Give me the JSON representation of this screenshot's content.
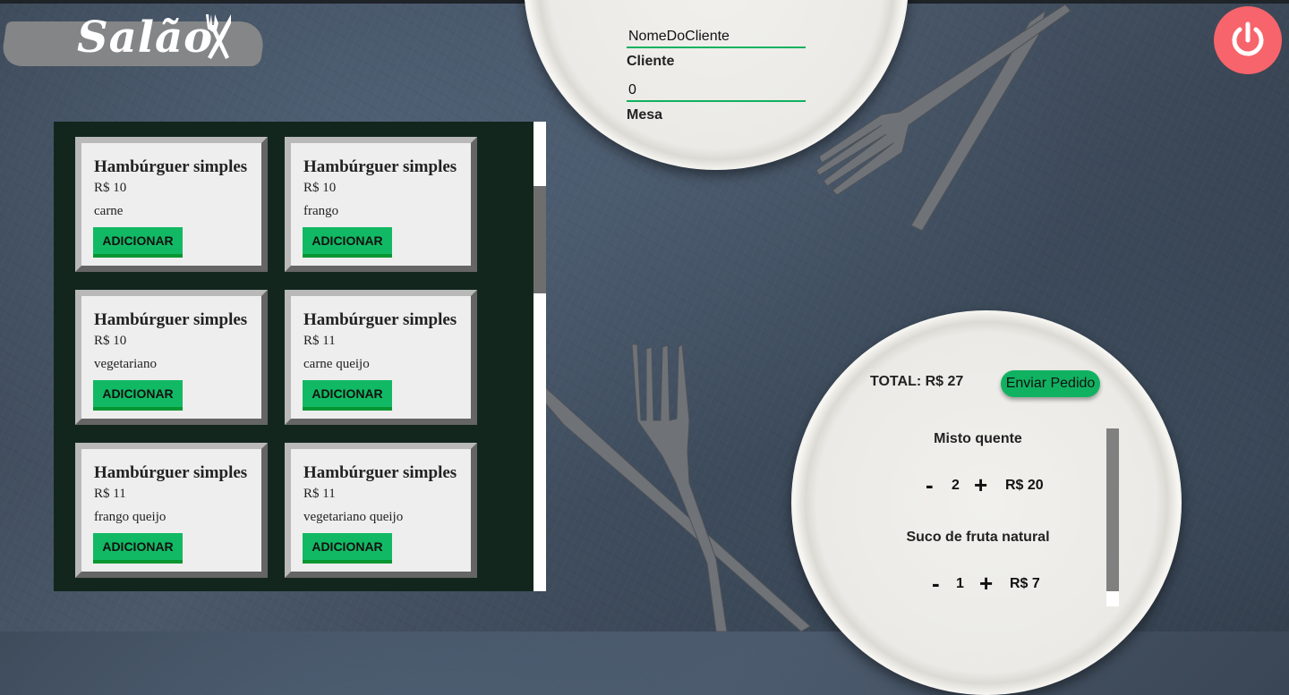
{
  "header": {
    "logo_text": "Salão"
  },
  "customer": {
    "name_value": "NomeDoCliente",
    "name_label": "Cliente",
    "table_value": "0",
    "table_label": "Mesa"
  },
  "menu": {
    "add_label": "ADICIONAR",
    "items": [
      {
        "name": "Hambúrguer simples",
        "price": "R$ 10",
        "description": "carne"
      },
      {
        "name": "Hambúrguer simples",
        "price": "R$ 10",
        "description": "frango"
      },
      {
        "name": "Hambúrguer simples",
        "price": "R$ 10",
        "description": "vegetariano"
      },
      {
        "name": "Hambúrguer simples",
        "price": "R$ 11",
        "description": "carne queijo"
      },
      {
        "name": "Hambúrguer simples",
        "price": "R$ 11",
        "description": "frango queijo"
      },
      {
        "name": "Hambúrguer simples",
        "price": "R$ 11",
        "description": "vegetariano queijo"
      }
    ]
  },
  "order": {
    "total_label": "TOTAL: R$ 27",
    "send_label": "Enviar Pedido",
    "minus_symbol": "-",
    "plus_symbol": "+",
    "items": [
      {
        "name": "Misto quente",
        "quantity": "2",
        "price": "R$ 20"
      },
      {
        "name": "Suco de fruta natural",
        "quantity": "1",
        "price": "R$ 7"
      }
    ]
  },
  "colors": {
    "accent_green": "#10b261",
    "power_red": "#f7646b",
    "menu_panel": "#12261e"
  },
  "icons": {
    "logo": "fork-knife-icon",
    "power": "power-icon"
  }
}
